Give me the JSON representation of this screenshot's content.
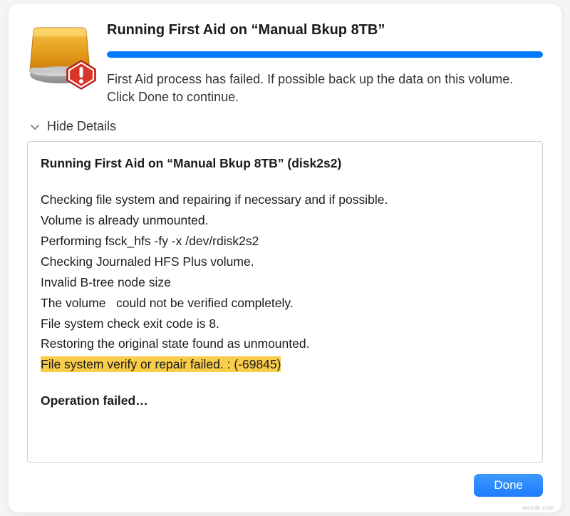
{
  "header": {
    "title": "Running First Aid on “Manual Bkup 8TB”",
    "message": "First Aid process has failed. If possible back up the data on this volume. Click Done to continue.",
    "progress_percent": 100
  },
  "details_toggle_label": "Hide Details",
  "details": {
    "title": "Running First Aid on “Manual Bkup 8TB” (disk2s2)",
    "log_lines": [
      "Checking file system and repairing if necessary and if possible.",
      "Volume is already unmounted.",
      "Performing fsck_hfs -fy -x /dev/rdisk2s2",
      "Checking Journaled HFS Plus volume.",
      "Invalid B-tree node size",
      "The volume   could not be verified completely.",
      "File system check exit code is 8.",
      "Restoring the original state found as unmounted."
    ],
    "highlighted_line": "File system verify or repair failed. : (-69845)",
    "operation_status": "Operation failed…"
  },
  "buttons": {
    "done": "Done"
  },
  "watermark": "wsxdn.com"
}
